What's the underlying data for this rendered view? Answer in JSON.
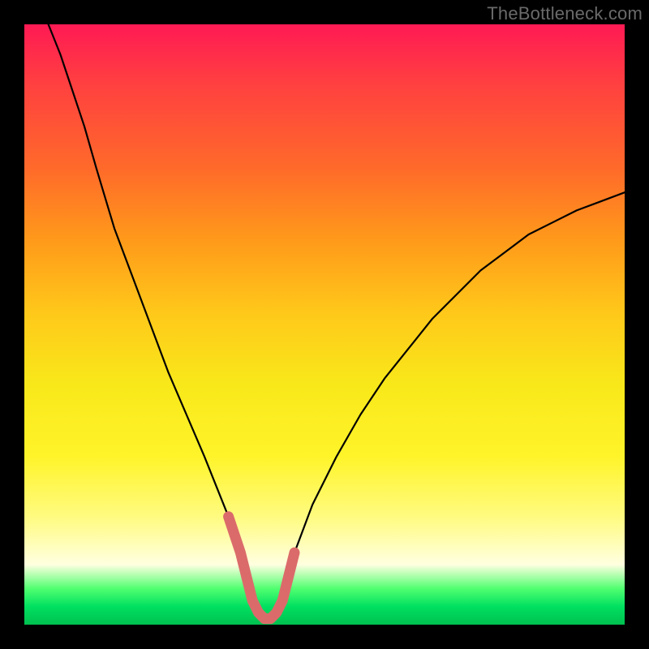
{
  "watermark": {
    "text": "TheBottleneck.com"
  },
  "chart_data": {
    "type": "line",
    "title": "",
    "xlabel": "",
    "ylabel": "",
    "xlim": [
      0,
      100
    ],
    "ylim": [
      0,
      100
    ],
    "grid": false,
    "series": [
      {
        "name": "bottleneck-curve",
        "color": "#000000",
        "x": [
          4,
          6,
          8,
          10,
          12,
          15,
          18,
          21,
          24,
          27,
          30,
          32,
          34,
          36,
          37,
          38,
          39,
          40,
          41,
          42,
          43,
          44,
          45,
          48,
          52,
          56,
          60,
          64,
          68,
          72,
          76,
          80,
          84,
          88,
          92,
          96,
          100
        ],
        "y": [
          100,
          95,
          89,
          83,
          76,
          66,
          58,
          50,
          42,
          35,
          28,
          23,
          18,
          12,
          8,
          4,
          2,
          1,
          1,
          2,
          4,
          8,
          12,
          20,
          28,
          35,
          41,
          46,
          51,
          55,
          59,
          62,
          65,
          67,
          69,
          70.5,
          72
        ]
      },
      {
        "name": "optimal-band-marker",
        "color": "#db6b6b",
        "x": [
          34,
          36,
          37,
          38,
          39,
          40,
          41,
          42,
          43,
          44,
          45
        ],
        "y": [
          18,
          12,
          8,
          4,
          2,
          1,
          1,
          2,
          4,
          8,
          12
        ]
      }
    ],
    "background_gradient_stops": [
      {
        "offset": 0.0,
        "color": "#ff1a54"
      },
      {
        "offset": 0.1,
        "color": "#ff4040"
      },
      {
        "offset": 0.24,
        "color": "#ff6a2a"
      },
      {
        "offset": 0.36,
        "color": "#ff9a1a"
      },
      {
        "offset": 0.48,
        "color": "#ffc81a"
      },
      {
        "offset": 0.6,
        "color": "#f8e81a"
      },
      {
        "offset": 0.72,
        "color": "#fff42a"
      },
      {
        "offset": 0.82,
        "color": "#fffb80"
      },
      {
        "offset": 0.9,
        "color": "#ffffe0"
      },
      {
        "offset": 0.94,
        "color": "#50ff70"
      },
      {
        "offset": 0.97,
        "color": "#00e060"
      },
      {
        "offset": 1.0,
        "color": "#00c050"
      }
    ]
  }
}
